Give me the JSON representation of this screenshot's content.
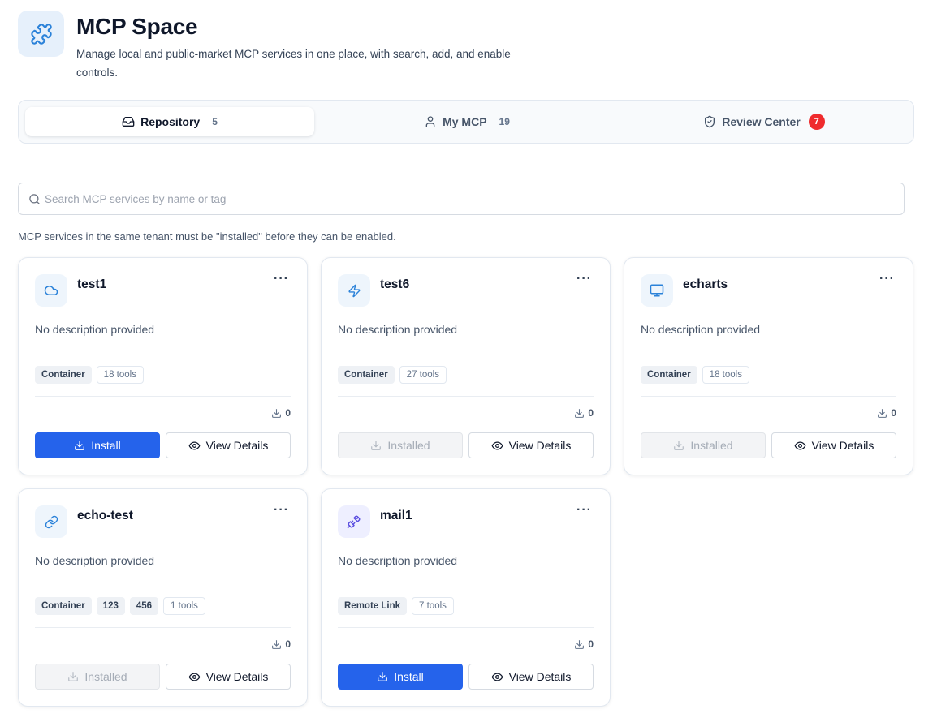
{
  "header": {
    "title": "MCP Space",
    "subtitle": "Manage local and public-market MCP services in one place, with search, add, and enable controls."
  },
  "tabs": [
    {
      "label": "Repository",
      "count": "5",
      "active": true
    },
    {
      "label": "My MCP",
      "count": "19",
      "active": false
    },
    {
      "label": "Review Center",
      "badge": "7",
      "active": false
    }
  ],
  "search": {
    "placeholder": "Search MCP services by name or tag",
    "value": ""
  },
  "note": "MCP services in the same tenant must be \"installed\" before they can be enabled.",
  "colors": {
    "accent": "#2563eb",
    "badge": "#ef2b2d",
    "icon_blue": "#2b82d9",
    "icon_purple": "#5b4fe0"
  },
  "cards": [
    {
      "name": "test1",
      "icon": "cloud-icon",
      "description": "No description provided",
      "tags": [
        "Container"
      ],
      "tools": "18 tools",
      "downloads": "0",
      "primary_label": "Install",
      "installed": false,
      "details_label": "View Details"
    },
    {
      "name": "test6",
      "icon": "zap-icon",
      "description": "No description provided",
      "tags": [
        "Container"
      ],
      "tools": "27 tools",
      "downloads": "0",
      "primary_label": "Installed",
      "installed": true,
      "details_label": "View Details"
    },
    {
      "name": "echarts",
      "icon": "monitor-icon",
      "description": "No description provided",
      "tags": [
        "Container"
      ],
      "tools": "18 tools",
      "downloads": "0",
      "primary_label": "Installed",
      "installed": true,
      "details_label": "View Details"
    },
    {
      "name": "echo-test",
      "icon": "link-icon",
      "description": "No description provided",
      "tags": [
        "Container",
        "123",
        "456"
      ],
      "tools": "1 tools",
      "downloads": "0",
      "primary_label": "Installed",
      "installed": true,
      "details_label": "View Details"
    },
    {
      "name": "mail1",
      "icon": "plug-icon",
      "description": "No description provided",
      "tags": [
        "Remote Link"
      ],
      "tools": "7 tools",
      "downloads": "0",
      "primary_label": "Install",
      "installed": false,
      "details_label": "View Details"
    }
  ]
}
